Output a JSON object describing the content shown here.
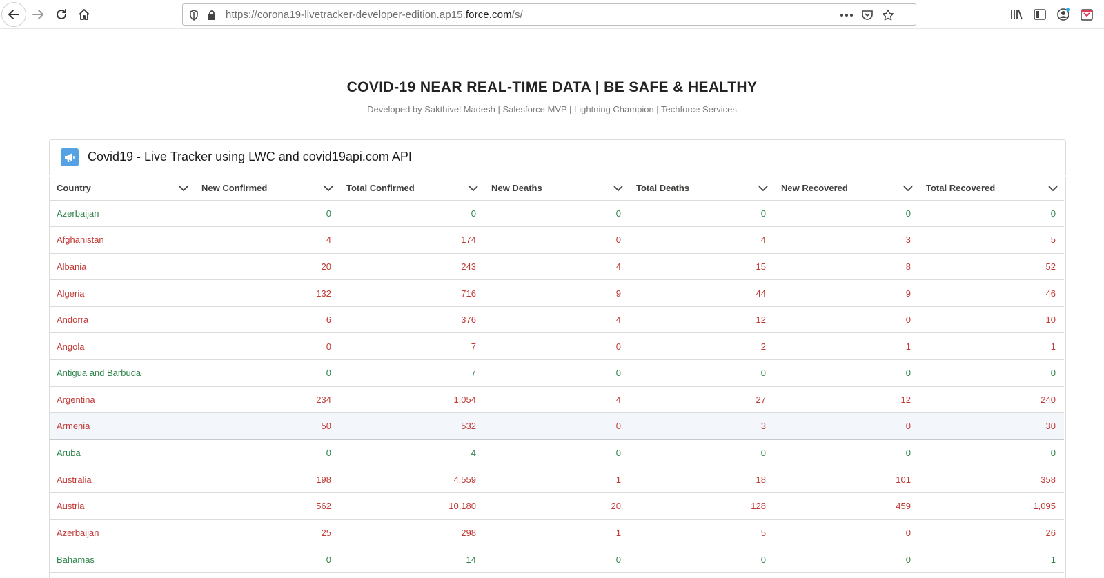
{
  "browser": {
    "url_prefix": "https://corona19-livetracker-developer-edition.ap15.",
    "url_domain": "force.com",
    "url_suffix": "/s/"
  },
  "page": {
    "title": "COVID-19 NEAR REAL-TIME DATA | BE SAFE & HEALTHY",
    "subtitle": "Developed by Sakthivel Madesh | Salesforce MVP | Lightning Champion | Techforce Services"
  },
  "card": {
    "title": "Covid19 - Live Tracker using LWC and covid19api.com API",
    "icon": "megaphone-icon",
    "accent": "#54a2e4"
  },
  "colors": {
    "green": "#2e844a",
    "red": "#c23934"
  },
  "table": {
    "columns": [
      "Country",
      "New Confirmed",
      "Total Confirmed",
      "New Deaths",
      "Total Deaths",
      "New Recovered",
      "Total Recovered"
    ],
    "rows": [
      {
        "status": "green",
        "cells": [
          "Azerbaijan",
          "0",
          "0",
          "0",
          "0",
          "0",
          "0"
        ]
      },
      {
        "status": "red",
        "cells": [
          "Afghanistan",
          "4",
          "174",
          "0",
          "4",
          "3",
          "5"
        ]
      },
      {
        "status": "red",
        "cells": [
          "Albania",
          "20",
          "243",
          "4",
          "15",
          "8",
          "52"
        ]
      },
      {
        "status": "red",
        "cells": [
          "Algeria",
          "132",
          "716",
          "9",
          "44",
          "9",
          "46"
        ]
      },
      {
        "status": "red",
        "cells": [
          "Andorra",
          "6",
          "376",
          "4",
          "12",
          "0",
          "10"
        ]
      },
      {
        "status": "red",
        "cells": [
          "Angola",
          "0",
          "7",
          "0",
          "2",
          "1",
          "1"
        ]
      },
      {
        "status": "green",
        "cells": [
          "Antigua and Barbuda",
          "0",
          "7",
          "0",
          "0",
          "0",
          "0"
        ]
      },
      {
        "status": "red",
        "cells": [
          "Argentina",
          "234",
          "1,054",
          "4",
          "27",
          "12",
          "240"
        ]
      },
      {
        "status": "red",
        "highlight": true,
        "cells": [
          "Armenia",
          "50",
          "532",
          "0",
          "3",
          "0",
          "30"
        ]
      },
      {
        "status": "green",
        "cells": [
          "Aruba",
          "0",
          "4",
          "0",
          "0",
          "0",
          "0"
        ]
      },
      {
        "status": "red",
        "cells": [
          "Australia",
          "198",
          "4,559",
          "1",
          "18",
          "101",
          "358"
        ]
      },
      {
        "status": "red",
        "cells": [
          "Austria",
          "562",
          "10,180",
          "20",
          "128",
          "459",
          "1,095"
        ]
      },
      {
        "status": "red",
        "cells": [
          "Azerbaijan",
          "25",
          "298",
          "1",
          "5",
          "0",
          "26"
        ]
      },
      {
        "status": "green",
        "cells": [
          "Bahamas",
          "0",
          "14",
          "0",
          "0",
          "0",
          "1"
        ]
      }
    ]
  }
}
